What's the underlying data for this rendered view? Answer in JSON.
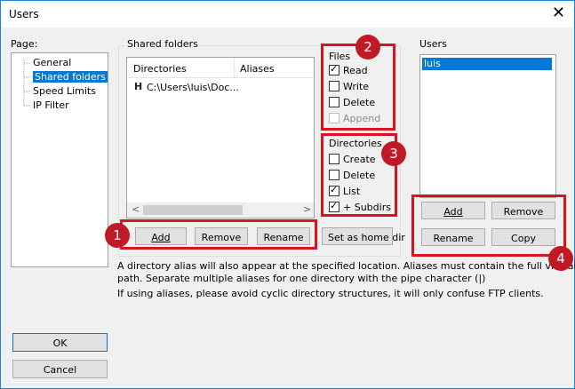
{
  "window": {
    "title": "Users",
    "close_symbol": "✕"
  },
  "page_panel": {
    "label": "Page:",
    "items": [
      {
        "label": "General",
        "selected": false
      },
      {
        "label": "Shared folders",
        "selected": true
      },
      {
        "label": "Speed Limits",
        "selected": false
      },
      {
        "label": "IP Filter",
        "selected": false
      }
    ]
  },
  "shared_folders": {
    "label": "Shared folders",
    "columns": [
      "Directories",
      "Aliases"
    ],
    "rows": [
      {
        "marker": "H",
        "directory": "C:\\Users\\luis\\Doc...",
        "alias": ""
      }
    ],
    "scroll_left": "<",
    "scroll_right": ">",
    "buttons": {
      "add": "Add",
      "remove": "Remove",
      "rename": "Rename",
      "home": "Set as home dir"
    }
  },
  "files": {
    "label": "Files",
    "options": [
      {
        "label": "Read",
        "checked": true,
        "enabled": true
      },
      {
        "label": "Write",
        "checked": false,
        "enabled": true
      },
      {
        "label": "Delete",
        "checked": false,
        "enabled": true
      },
      {
        "label": "Append",
        "checked": false,
        "enabled": false
      }
    ]
  },
  "directories": {
    "label": "Directories",
    "options": [
      {
        "label": "Create",
        "checked": false
      },
      {
        "label": "Delete",
        "checked": false
      },
      {
        "label": "List",
        "checked": true
      },
      {
        "label": "+ Subdirs",
        "checked": true
      }
    ]
  },
  "users": {
    "label": "Users",
    "list": [
      "luis"
    ],
    "buttons": {
      "add": "Add",
      "remove": "Remove",
      "rename": "Rename",
      "copy": "Copy"
    }
  },
  "info": {
    "line1": "A directory alias will also appear at the specified location. Aliases must contain the full virtual",
    "line2": "path. Separate multiple aliases for one directory with the pipe character (|)",
    "line3": "If using aliases, please avoid cyclic directory structures, it will only confuse FTP clients."
  },
  "footer": {
    "ok": "OK",
    "cancel": "Cancel"
  },
  "annotations": {
    "badge1": "1",
    "badge2": "2",
    "badge3": "3",
    "badge4": "4",
    "color": "#d8141c"
  }
}
